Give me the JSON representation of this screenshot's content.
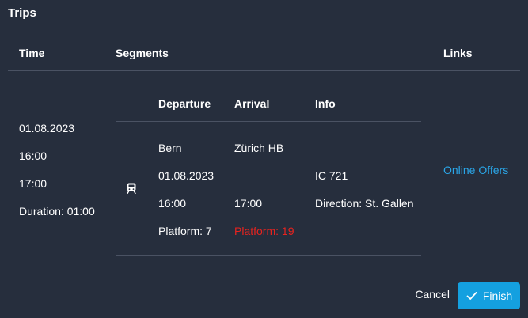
{
  "dialog": {
    "title": "Trips"
  },
  "table": {
    "headers": {
      "time": "Time",
      "segments": "Segments",
      "links": "Links"
    },
    "row": {
      "time": {
        "date": "01.08.2023",
        "range_start": "16:00 –",
        "range_end": "17:00",
        "duration": "Duration: 01:00"
      },
      "segment_headers": {
        "departure": "Departure",
        "arrival": "Arrival",
        "info": "Info"
      },
      "segment": {
        "departure": {
          "station": "Bern",
          "date": "01.08.2023",
          "time": "16:00",
          "platform": "Platform: 7"
        },
        "arrival": {
          "station": "Zürich HB",
          "time": "17:00",
          "platform": "Platform: 19"
        },
        "info": {
          "train": "IC 721",
          "direction": "Direction: St. Gallen"
        },
        "icon": "train-icon"
      },
      "links": {
        "online_offers": "Online Offers"
      }
    }
  },
  "footer": {
    "cancel_label": "Cancel",
    "finish_label": "Finish"
  },
  "colors": {
    "background": "#262e3d",
    "accent": "#14a0e0",
    "link": "#2aa6e8",
    "warning_text": "#e8231f",
    "divider": "#4a5263"
  }
}
